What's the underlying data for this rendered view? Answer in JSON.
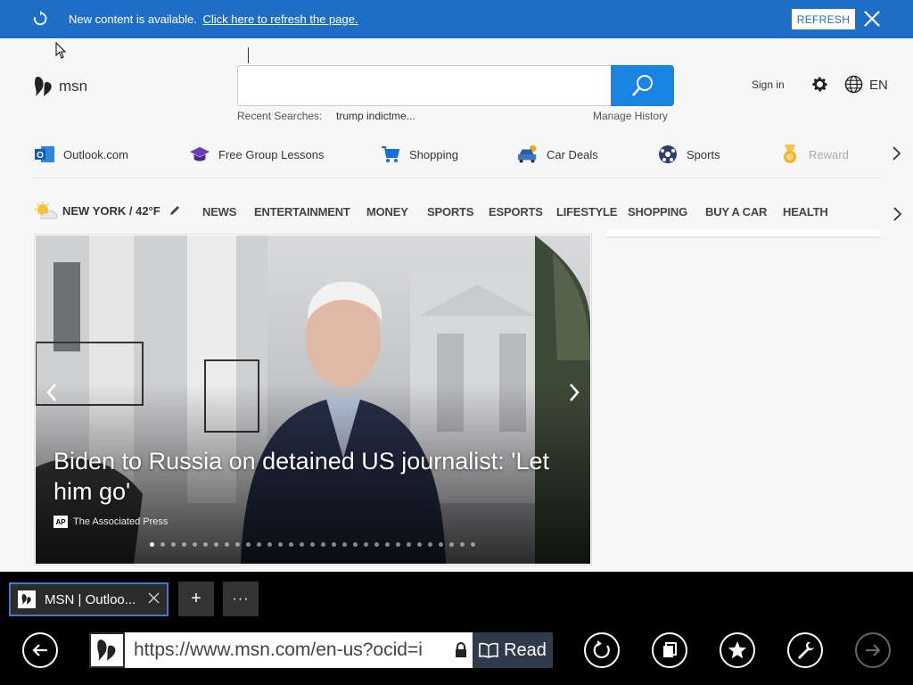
{
  "notification": {
    "message": "New content is available.",
    "link": "Click here to refresh the page.",
    "button": "REFRESH"
  },
  "header": {
    "logo_text": "msn",
    "search_placeholder": "",
    "recent_label": "Recent Searches:",
    "recent_item": "trump indictme...",
    "manage_history": "Manage History",
    "sign_in": "Sign in",
    "language": "EN"
  },
  "quick_links": [
    {
      "label": "Outlook.com",
      "icon": "outlook-icon"
    },
    {
      "label": "Free Group Lessons",
      "icon": "graduation-cap-icon"
    },
    {
      "label": "Shopping",
      "icon": "shopping-cart-icon"
    },
    {
      "label": "Car Deals",
      "icon": "car-icon"
    },
    {
      "label": "Sports",
      "icon": "soccer-ball-icon"
    },
    {
      "label": "Reward",
      "icon": "medal-icon"
    }
  ],
  "nav": {
    "weather": "NEW YORK / 42°F",
    "items": [
      "NEWS",
      "ENTERTAINMENT",
      "MONEY",
      "SPORTS",
      "ESPORTS",
      "LIFESTYLE",
      "SHOPPING",
      "BUY A CAR",
      "HEALTH"
    ]
  },
  "hero": {
    "title": "Biden to Russia on detained US journalist: 'Let him go'",
    "source": "The Associated Press",
    "source_logo": "AP",
    "slide_count": 31,
    "active_slide": 0
  },
  "browser": {
    "tab_title": "MSN | Outloo...",
    "new_tab": "+",
    "more": "···",
    "url": "https://www.msn.com/en-us?ocid=i",
    "read_label": "Read"
  },
  "colors": {
    "notify_bg": "#1e6ec5",
    "search_button": "#1a84e3",
    "tab_border": "#3c7cc7"
  }
}
